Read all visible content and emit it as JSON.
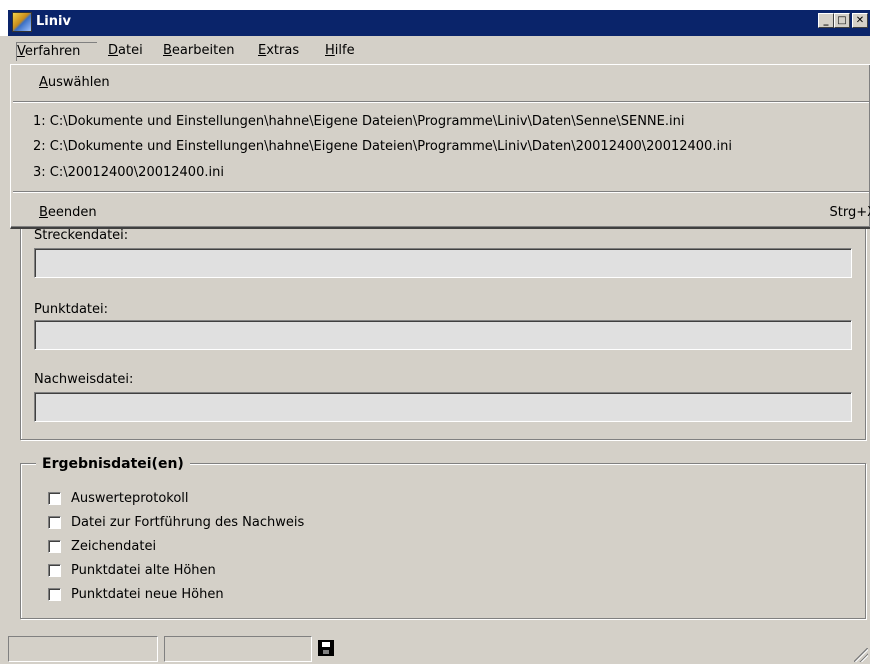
{
  "window": {
    "title": "Liniv"
  },
  "title_buttons": {
    "minimize": "_",
    "maximize": "□",
    "close": "✕"
  },
  "menubar": [
    {
      "label": "Verfahren",
      "mnemonic": "V",
      "rest": "erfahren"
    },
    {
      "label": "Datei",
      "mnemonic": "D",
      "rest": "atei"
    },
    {
      "label": "Bearbeiten",
      "mnemonic": "B",
      "rest": "earbeiten"
    },
    {
      "label": "Extras",
      "mnemonic": "E",
      "rest": "xtras"
    },
    {
      "label": "Hilfe",
      "mnemonic": "H",
      "rest": "ilfe"
    }
  ],
  "dropdown": {
    "select": {
      "mnemonic": "A",
      "rest": "uswählen"
    },
    "recent": [
      "1: C:\\Dokumente und Einstellungen\\hahne\\Eigene Dateien\\Programme\\Liniv\\Daten\\Senne\\SENNE.ini",
      "2: C:\\Dokumente und Einstellungen\\hahne\\Eigene Dateien\\Programme\\Liniv\\Daten\\20012400\\20012400.ini",
      "3: C:\\20012400\\20012400.ini"
    ],
    "exit": {
      "mnemonic": "B",
      "rest": "eenden",
      "shortcut": "Strg+X"
    }
  },
  "input_files": {
    "fields": [
      {
        "label": "Streckendatei:",
        "value": ""
      },
      {
        "label": "Punktdatei:",
        "value": ""
      },
      {
        "label": "Nachweisdatei:",
        "value": ""
      }
    ]
  },
  "result_files": {
    "legend": "Ergebnisdatei(en)",
    "checkboxes": [
      {
        "label": "Auswerteprotokoll",
        "checked": false
      },
      {
        "label": "Datei zur Fortführung des Nachweis",
        "checked": false
      },
      {
        "label": "Zeichendatei",
        "checked": false
      },
      {
        "label": "Punktdatei alte Höhen",
        "checked": false
      },
      {
        "label": "Punktdatei neue Höhen",
        "checked": false
      }
    ]
  },
  "statusbar": {
    "panel1": "",
    "panel2": "",
    "icon": "floppy-disk-icon"
  }
}
